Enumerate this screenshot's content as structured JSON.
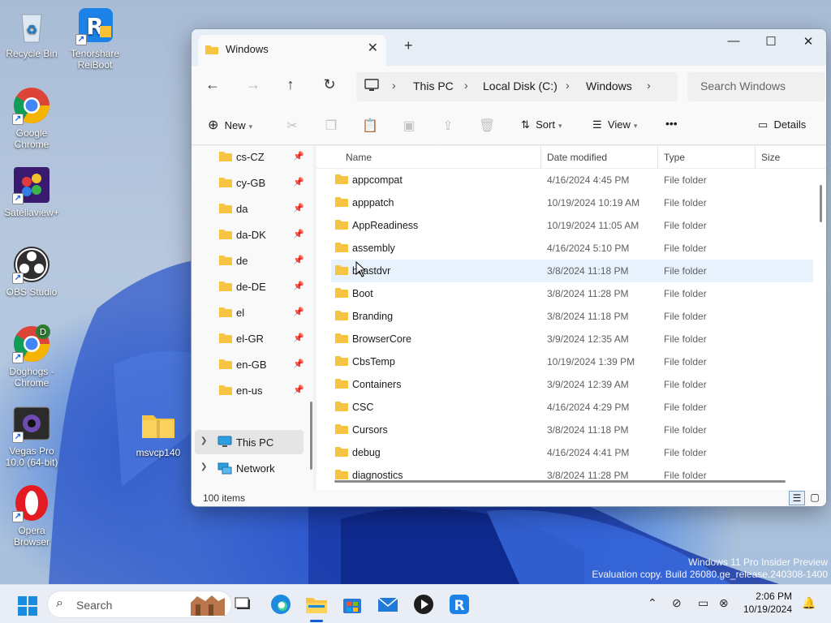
{
  "desktop": {
    "icons": [
      {
        "label": "Recycle Bin",
        "icon": "recycle-bin-icon"
      },
      {
        "label": "Tenorshare ReiBoot",
        "icon": "reiboot-icon"
      },
      {
        "label": "Google Chrome",
        "icon": "chrome-icon"
      },
      {
        "label": "Satellaview+",
        "icon": "satellaview-icon"
      },
      {
        "label": "OBS Studio",
        "icon": "obs-icon"
      },
      {
        "label": "Doghogs - Chrome",
        "icon": "chrome-profile-icon"
      },
      {
        "label": "Vegas Pro 10.0 (64-bit)",
        "icon": "vegas-icon"
      },
      {
        "label": "Opera Browser",
        "icon": "opera-icon"
      },
      {
        "label": "msvcp140",
        "icon": "zip-folder-icon"
      }
    ],
    "watermark_line1": "Windows 11 Pro Insider Preview",
    "watermark_line2": "Evaluation copy. Build 26080.ge_release.240308-1400"
  },
  "window": {
    "tab_title": "Windows",
    "breadcrumb": [
      "This PC",
      "Local Disk (C:)",
      "Windows"
    ],
    "search_placeholder": "Search Windows",
    "toolbar": {
      "new": "New",
      "sort": "Sort",
      "view": "View",
      "more": "•••",
      "details": "Details"
    },
    "nav_items": [
      {
        "label": "cs-CZ"
      },
      {
        "label": "cy-GB"
      },
      {
        "label": "da"
      },
      {
        "label": "da-DK"
      },
      {
        "label": "de"
      },
      {
        "label": "de-DE"
      },
      {
        "label": "el"
      },
      {
        "label": "el-GR"
      },
      {
        "label": "en-GB"
      },
      {
        "label": "en-us"
      }
    ],
    "nav_roots": [
      {
        "label": "This PC"
      },
      {
        "label": "Network"
      }
    ],
    "columns": {
      "name": "Name",
      "date": "Date modified",
      "type": "Type",
      "size": "Size"
    },
    "rows": [
      {
        "name": "appcompat",
        "date": "4/16/2024 4:45 PM",
        "type": "File folder"
      },
      {
        "name": "apppatch",
        "date": "10/19/2024 10:19 AM",
        "type": "File folder"
      },
      {
        "name": "AppReadiness",
        "date": "10/19/2024 11:05 AM",
        "type": "File folder"
      },
      {
        "name": "assembly",
        "date": "4/16/2024 5:10 PM",
        "type": "File folder"
      },
      {
        "name": "bcastdvr",
        "date": "3/8/2024 11:18 PM",
        "type": "File folder"
      },
      {
        "name": "Boot",
        "date": "3/8/2024 11:28 PM",
        "type": "File folder"
      },
      {
        "name": "Branding",
        "date": "3/8/2024 11:18 PM",
        "type": "File folder"
      },
      {
        "name": "BrowserCore",
        "date": "3/9/2024 12:35 AM",
        "type": "File folder"
      },
      {
        "name": "CbsTemp",
        "date": "10/19/2024 1:39 PM",
        "type": "File folder"
      },
      {
        "name": "Containers",
        "date": "3/9/2024 12:39 AM",
        "type": "File folder"
      },
      {
        "name": "CSC",
        "date": "4/16/2024 4:29 PM",
        "type": "File folder"
      },
      {
        "name": "Cursors",
        "date": "3/8/2024 11:18 PM",
        "type": "File folder"
      },
      {
        "name": "debug",
        "date": "4/16/2024 4:41 PM",
        "type": "File folder"
      },
      {
        "name": "diagnostics",
        "date": "3/8/2024 11:28 PM",
        "type": "File folder"
      }
    ],
    "status": "100 items"
  },
  "taskbar": {
    "search_label": "Search",
    "time": "2:06 PM",
    "date": "10/19/2024"
  },
  "colors": {
    "accent": "#0b5ed7",
    "folder": "#f6c342",
    "row_hover": "#e8f2fc"
  }
}
